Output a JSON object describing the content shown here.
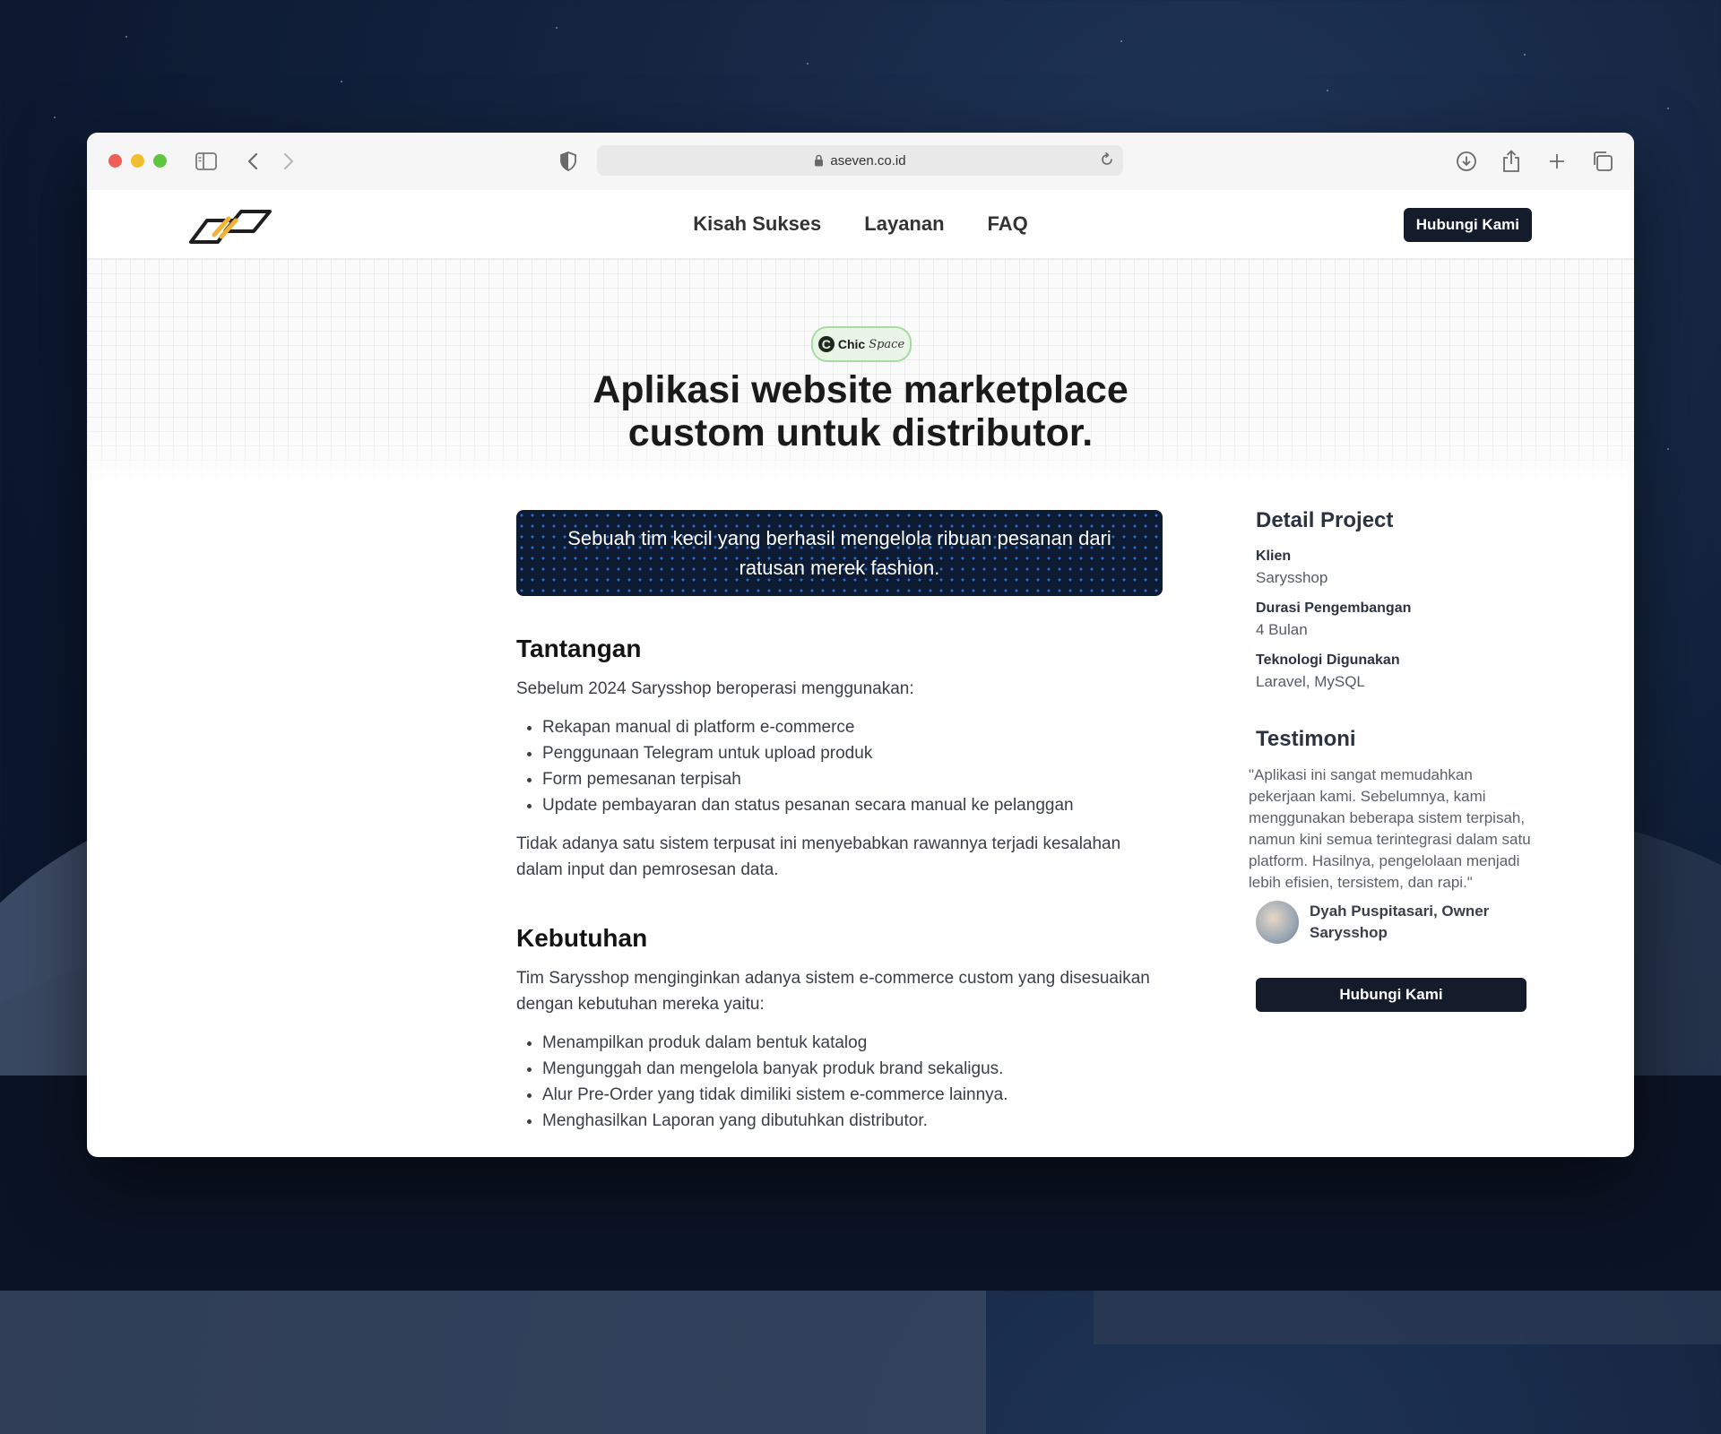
{
  "browser": {
    "url": "aseven.co.id"
  },
  "nav": {
    "links": [
      "Kisah Sukses",
      "Layanan",
      "FAQ"
    ],
    "cta": "Hubungi Kami"
  },
  "hero": {
    "badge_part1": "Chic",
    "badge_part2": "Space",
    "title_line1": "Aplikasi website marketplace",
    "title_line2": "custom untuk distributor."
  },
  "banner": {
    "text": "Sebuah tim kecil yang berhasil mengelola ribuan pesanan dari ratusan merek fashion."
  },
  "tantangan": {
    "heading": "Tantangan",
    "intro": "Sebelum 2024 Sarysshop beroperasi menggunakan:",
    "items": [
      "Rekapan manual di platform e-commerce",
      "Penggunaan Telegram untuk upload produk",
      "Form pemesanan terpisah",
      "Update pembayaran dan status pesanan secara manual ke pelanggan"
    ],
    "outro": "Tidak adanya satu sistem terpusat ini menyebabkan rawannya terjadi kesalahan dalam input dan pemrosesan data."
  },
  "kebutuhan": {
    "heading": "Kebutuhan",
    "intro": "Tim Sarysshop menginginkan adanya sistem e-commerce custom yang disesuaikan dengan kebutuhan mereka yaitu:",
    "items": [
      "Menampilkan produk dalam bentuk katalog",
      "Mengunggah dan mengelola banyak produk brand sekaligus.",
      "Alur Pre-Order yang tidak dimiliki sistem e-commerce lainnya.",
      "Menghasilkan Laporan yang dibutuhkan distributor."
    ]
  },
  "detail": {
    "heading": "Detail Project",
    "rows": [
      {
        "label": "Klien",
        "value": "Sarysshop"
      },
      {
        "label": "Durasi Pengembangan",
        "value": "4 Bulan"
      },
      {
        "label": "Teknologi Digunakan",
        "value": "Laravel, MySQL"
      }
    ]
  },
  "testimoni": {
    "heading": "Testimoni",
    "quote": "\"Aplikasi ini sangat memudahkan pekerjaan kami. Sebelumnya, kami menggunakan beberapa sistem terpisah, namun kini semua terintegrasi dalam satu platform. Hasilnya, pengelolaan menjadi lebih efisien, tersistem, dan rapi.\"",
    "author": "Dyah Puspitasari, Owner Sarysshop",
    "cta": "Hubungi Kami"
  },
  "colors": {
    "dark_button": "#141c2b",
    "banner_bg": "#0d1b33",
    "logo_accent": "#f2b233"
  }
}
